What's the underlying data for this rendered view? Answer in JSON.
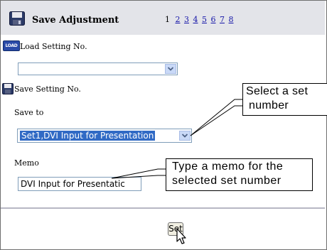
{
  "header": {
    "title": "Save Adjustment",
    "current_page": "1",
    "page_links": [
      "2",
      "3",
      "4",
      "5",
      "6",
      "7",
      "8"
    ]
  },
  "load": {
    "icon_text": "LOAD",
    "label": "Load Setting No.",
    "selected": ""
  },
  "save": {
    "label": "Save Setting No.",
    "save_to_label": "Save to",
    "selected": "Set1,DVI Input for Presentation"
  },
  "memo": {
    "label": "Memo",
    "value": "DVI Input for Presentatic"
  },
  "set_button": "Set",
  "callouts": {
    "select_set_line1": "Select a set",
    "select_set_line2": "number",
    "type_memo_line1": "Type a memo for the",
    "type_memo_line2": "selected set number"
  },
  "colors": {
    "header_bg": "#e3e4e9",
    "link": "#1515a8",
    "selection": "#316ac5",
    "dropdown_button": "#c9d9f7"
  }
}
